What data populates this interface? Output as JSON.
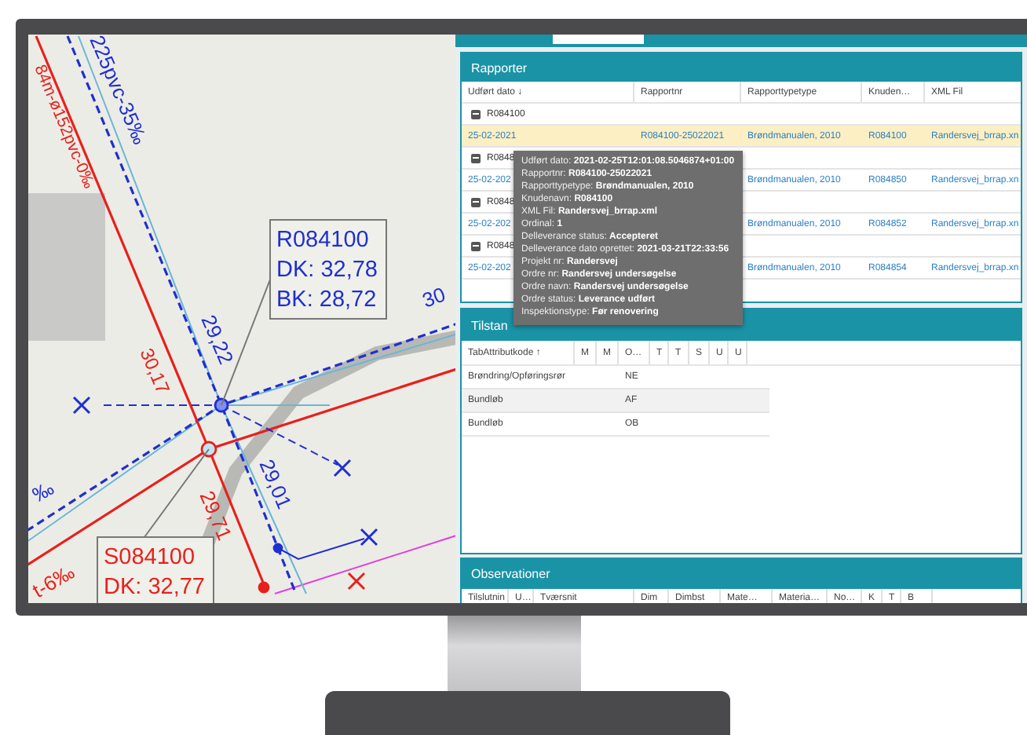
{
  "map": {
    "labels": [
      {
        "text": "84m-ø152pvc-0‰",
        "color": "#e8201c"
      },
      {
        "text": "225pvc-35‰",
        "color": "#1f2fd0"
      },
      {
        "text": "29,22",
        "color": "#1f2fd0"
      },
      {
        "text": "30,17",
        "color": "#e8201c"
      },
      {
        "text": "29,01",
        "color": "#1f2fd0"
      },
      {
        "text": "29,71",
        "color": "#e8201c"
      },
      {
        "text": "30",
        "color": "#1f2fd0"
      },
      {
        "text": "t-6‰",
        "color": "#e8201c"
      },
      {
        "text": "‰",
        "color": "#1f2fd0"
      }
    ],
    "callouts": [
      {
        "lines": [
          "R084100",
          "DK: 32,78",
          "BK: 28,72"
        ],
        "color": "#1f2fd0"
      },
      {
        "lines": [
          "S084100",
          "DK: 32,77"
        ],
        "color": "#e8201c"
      }
    ]
  },
  "rapporter": {
    "title": "Rapporter",
    "columns": [
      "Udført dato ↓",
      "Rapportnr",
      "Rapporttypetype",
      "Knuden…",
      "XML Fil"
    ],
    "groups": [
      {
        "label": "R084100",
        "expanded": true,
        "rows": [
          {
            "selected": true,
            "date": "25-02-2021",
            "report_no": "R084100-25022021",
            "report_type": "Brøndmanualen, 2010",
            "node": "R084100",
            "xml": "Randersvej_brrap.xn"
          }
        ]
      },
      {
        "label": "R0848",
        "expanded": true,
        "rows": [
          {
            "selected": false,
            "date": "25-02-202",
            "report_type": "Brøndmanualen, 2010",
            "node": "R084850",
            "xml": "Randersvej_brrap.xn"
          }
        ]
      },
      {
        "label": "R0848",
        "expanded": true,
        "rows": [
          {
            "selected": false,
            "date": "25-02-202",
            "report_type": "Brøndmanualen, 2010",
            "node": "R084852",
            "xml": "Randersvej_brrap.xn"
          }
        ]
      },
      {
        "label": "R0848",
        "expanded": true,
        "rows": [
          {
            "selected": false,
            "date": "25-02-202",
            "report_type": "Brøndmanualen, 2010",
            "node": "R084854",
            "xml": "Randersvej_brrap.xn"
          }
        ]
      }
    ]
  },
  "tooltip": [
    "Udført dato: **2021-02-25T12:01:08.5046874+01:00**",
    "Rapportnr: **R084100-25022021**",
    "Rapporttypetype: **Brøndmanualen, 2010**",
    "Knudenavn: **R084100**",
    "XML Fil: **Randersvej_brrap.xml**",
    "Ordinal: **1**",
    "Delleverance status: **Accepteret**",
    "Delleverance dato oprettet: **2021-03-21T22:33:56**",
    "Projekt nr: **Randersvej**",
    "Ordre nr: **Randersvej undersøgelse**",
    "Ordre navn: **Randersvej undersøgelse**",
    "Ordre status: **Leverance udført**",
    "Inspektionstype: **Før renovering**"
  ],
  "tilstand": {
    "title": "Tilstan",
    "columns": [
      "TabAttributkode ↑",
      "M",
      "M",
      "O…",
      "T",
      "T",
      "S",
      "U",
      "U"
    ],
    "rows": [
      [
        "Brøndring/Opføringsrør",
        "",
        "",
        "NE"
      ],
      [
        "Bundløb",
        "",
        "",
        "AF"
      ],
      [
        "Bundløb",
        "",
        "",
        "OB"
      ]
    ]
  },
  "observationer": {
    "title": "Observationer",
    "columns": [
      "Tilslutnin",
      "U…",
      "Tværsnit",
      "Dim",
      "Dimbst",
      "Mate…",
      "Materia…",
      "No…",
      "K",
      "T",
      "B"
    ]
  }
}
